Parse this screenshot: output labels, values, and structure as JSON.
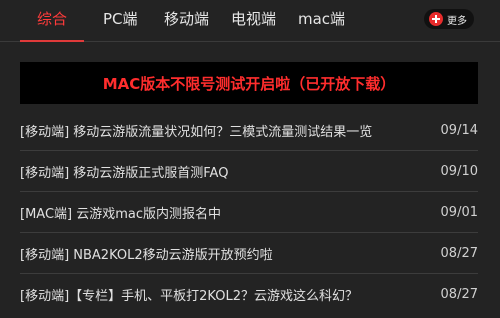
{
  "tabs": [
    {
      "label": "综合",
      "active": true
    },
    {
      "label": "PC端",
      "active": false
    },
    {
      "label": "移动端",
      "active": false
    },
    {
      "label": "电视端",
      "active": false
    },
    {
      "label": "mac端",
      "active": false
    }
  ],
  "more_button": {
    "label": "更多",
    "icon": "plus-circle-icon"
  },
  "banner": {
    "text": "MAC版本不限号测试开启啦（已开放下载）"
  },
  "news": [
    {
      "title": "[移动端] 移动云游版流量状况如何？三模式流量测试结果一览",
      "date": "09/14"
    },
    {
      "title": "[移动端] 移动云游版正式服首测FAQ",
      "date": "09/10"
    },
    {
      "title": "[MAC端] 云游戏mac版内测报名中",
      "date": "09/01"
    },
    {
      "title": "[移动端] NBA2KOL2移动云游版开放预约啦",
      "date": "08/27"
    },
    {
      "title": "[移动端]【专栏】手机、平板打2KOL2？云游戏这么科幻？",
      "date": "08/27"
    }
  ],
  "colors": {
    "background": "#232323",
    "accent": "#ff3b3b",
    "banner_bg": "#000000"
  }
}
